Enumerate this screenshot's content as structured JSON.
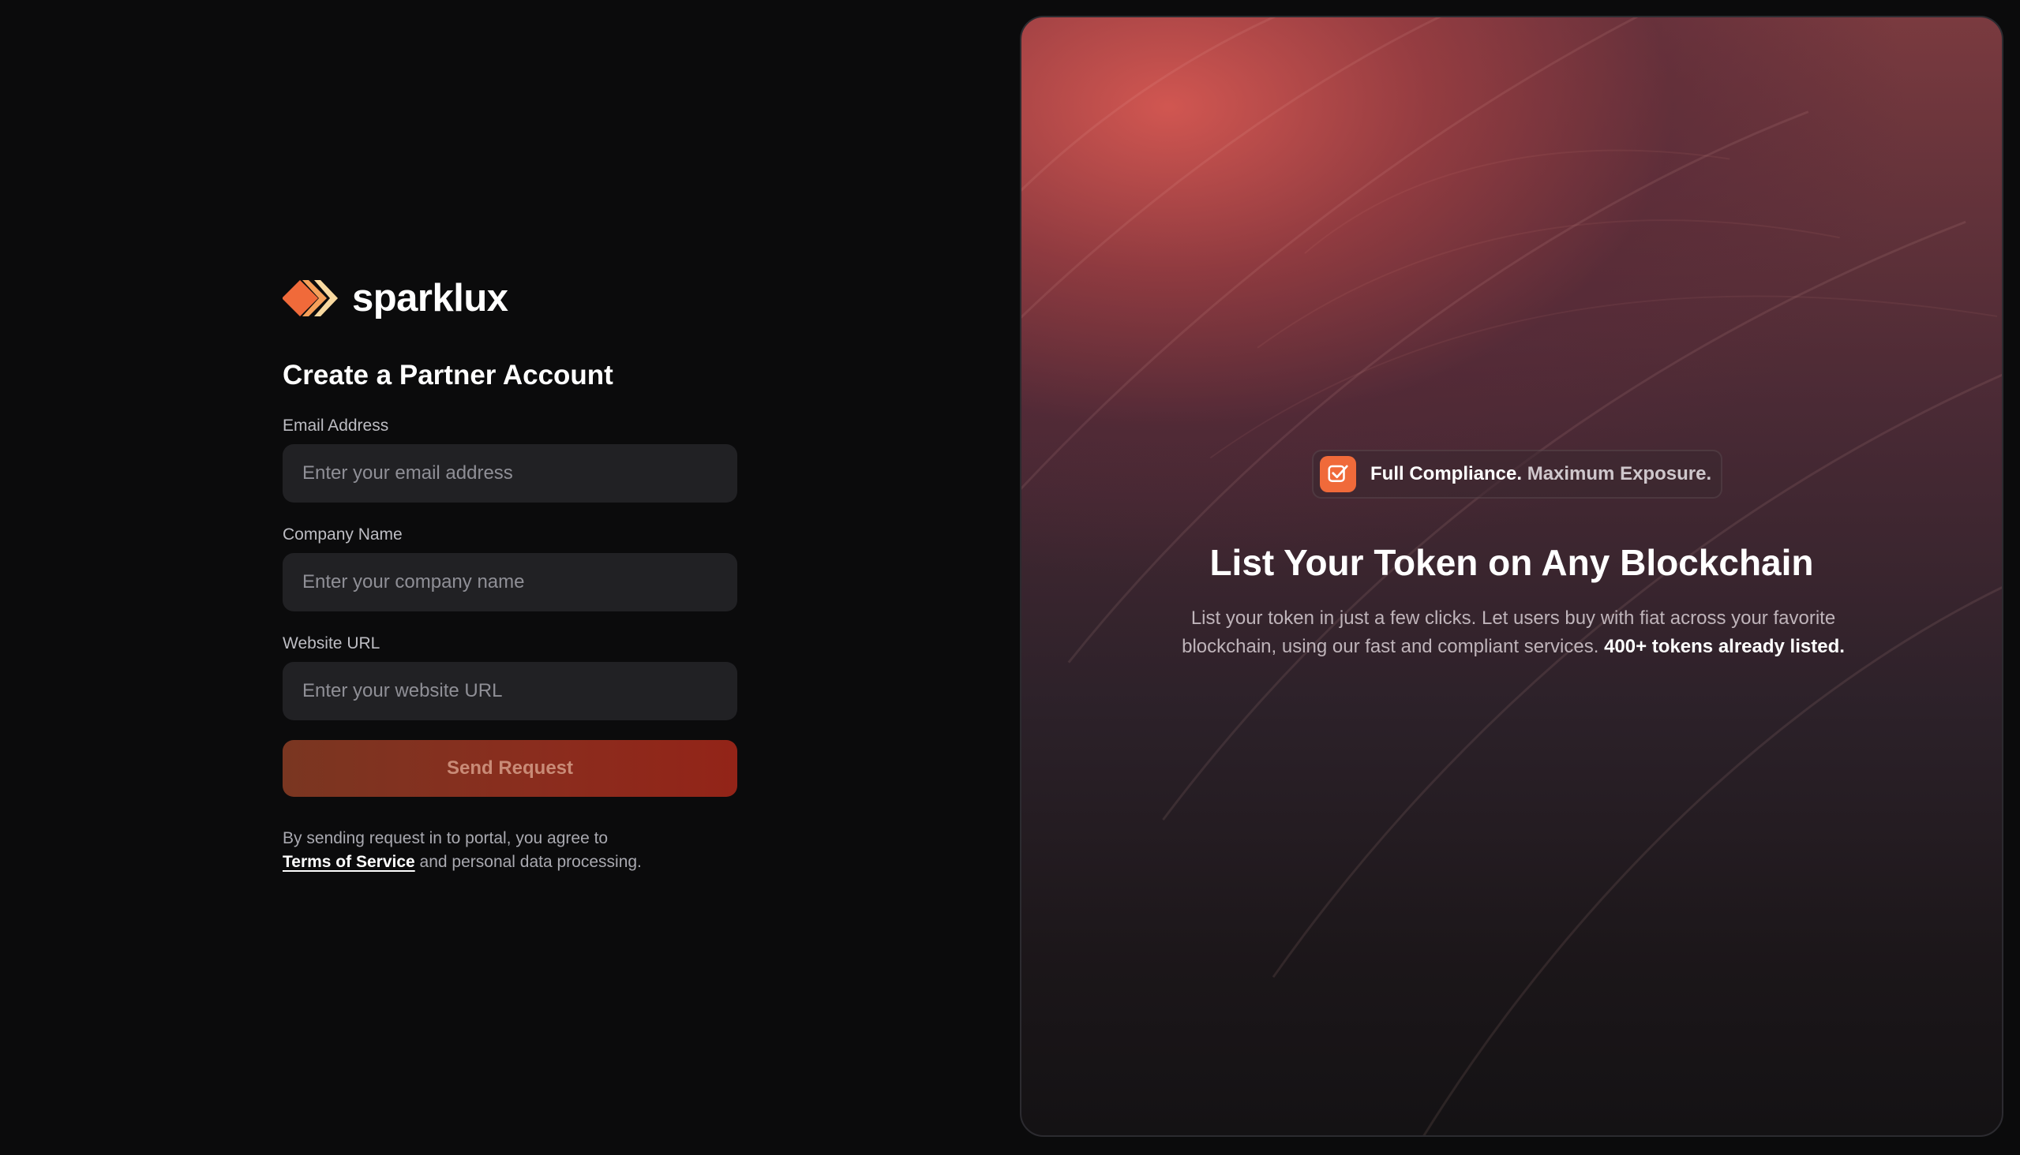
{
  "brand": {
    "name": "sparklux",
    "colors": {
      "primary": "#f06a3a",
      "secondary": "#f5a05a",
      "tertiary": "#f8d9a0"
    }
  },
  "form": {
    "title": "Create a Partner Account",
    "fields": [
      {
        "label": "Email Address",
        "placeholder": "Enter your email address",
        "value": ""
      },
      {
        "label": "Company Name",
        "placeholder": "Enter your company name",
        "value": ""
      },
      {
        "label": "Website URL",
        "placeholder": "Enter your website URL",
        "value": ""
      }
    ],
    "submit_label": "Send Request",
    "legal": {
      "prefix": "By sending request in to portal, you agree to",
      "link": "Terms of Service",
      "suffix": " and personal data processing."
    }
  },
  "hero": {
    "badge": {
      "icon": "checkbox-icon",
      "strong": "Full Compliance.",
      "soft": "Maximum Exposure."
    },
    "title": "List Your Token on Any Blockchain",
    "description": "List your token in just a few clicks. Let users buy with fiat across your favorite blockchain, using our fast and compliant services.",
    "highlight": "400+ tokens already listed."
  }
}
